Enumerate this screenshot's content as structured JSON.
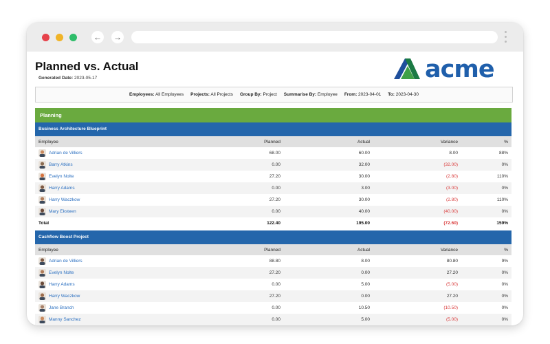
{
  "browser": {
    "colors": {
      "close": "#e6424b",
      "minimize": "#f0b428",
      "maximize": "#2fbd6a"
    }
  },
  "report": {
    "title": "Planned vs. Actual",
    "generated_label": "Generated Date:",
    "generated_value": "2023-05-17",
    "logo_text": "acme",
    "filters": [
      {
        "key": "Employees:",
        "value": "All Employees"
      },
      {
        "key": "Projects:",
        "value": "All Projects"
      },
      {
        "key": "Group By:",
        "value": "Project"
      },
      {
        "key": "Summarise By:",
        "value": "Employee"
      },
      {
        "key": "From:",
        "value": "2023-04-01"
      },
      {
        "key": "To:",
        "value": "2023-04-30"
      }
    ],
    "section_title": "Planning",
    "columns": [
      "Employee",
      "Planned",
      "Actual",
      "Variance",
      "%"
    ],
    "projects": [
      {
        "name": "Business Architecture Blueprint",
        "rows": [
          {
            "employee": "Adrian de Villiers",
            "planned": "68.00",
            "actual": "60.00",
            "variance": "8.00",
            "pct": "88%",
            "negative": false
          },
          {
            "employee": "Barry Atkins",
            "planned": "0.00",
            "actual": "32.00",
            "variance": "(32.00)",
            "pct": "0%",
            "negative": true
          },
          {
            "employee": "Evelyn Nolte",
            "planned": "27.20",
            "actual": "30.00",
            "variance": "(2.80)",
            "pct": "110%",
            "negative": true
          },
          {
            "employee": "Harry Adams",
            "planned": "0.00",
            "actual": "3.00",
            "variance": "(3.00)",
            "pct": "0%",
            "negative": true
          },
          {
            "employee": "Harry Waczkow",
            "planned": "27.20",
            "actual": "30.00",
            "variance": "(2.80)",
            "pct": "110%",
            "negative": true
          },
          {
            "employee": "Mary Eksteen",
            "planned": "0.00",
            "actual": "40.00",
            "variance": "(40.00)",
            "pct": "0%",
            "negative": true
          }
        ],
        "total": {
          "label": "Total",
          "planned": "122.40",
          "actual": "195.00",
          "variance": "(72.60)",
          "pct": "159%"
        }
      },
      {
        "name": "Cashflow Boost Project",
        "rows": [
          {
            "employee": "Adrian de Villiers",
            "planned": "88.80",
            "actual": "8.00",
            "variance": "80.80",
            "pct": "9%",
            "negative": false
          },
          {
            "employee": "Evelyn Nolte",
            "planned": "27.20",
            "actual": "0.00",
            "variance": "27.20",
            "pct": "0%",
            "negative": false
          },
          {
            "employee": "Harry Adams",
            "planned": "0.00",
            "actual": "5.00",
            "variance": "(5.00)",
            "pct": "0%",
            "negative": true
          },
          {
            "employee": "Harry Waczkow",
            "planned": "27.20",
            "actual": "0.00",
            "variance": "27.20",
            "pct": "0%",
            "negative": false
          },
          {
            "employee": "Jane Branch",
            "planned": "0.00",
            "actual": "10.50",
            "variance": "(10.50)",
            "pct": "0%",
            "negative": true
          },
          {
            "employee": "Manny Sanchez",
            "planned": "0.00",
            "actual": "5.00",
            "variance": "(5.00)",
            "pct": "0%",
            "negative": true
          }
        ]
      }
    ]
  }
}
